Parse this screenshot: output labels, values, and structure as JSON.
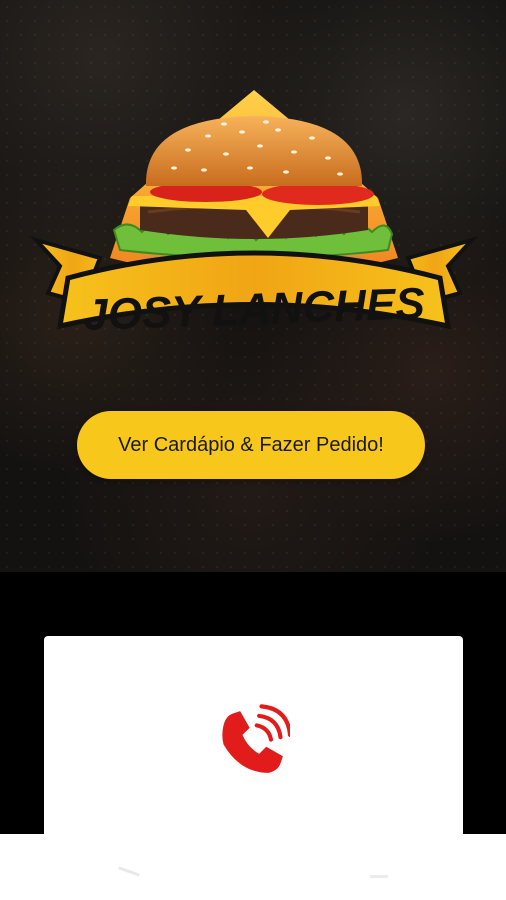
{
  "brand": {
    "name": "JOSY LANCHES"
  },
  "cta": {
    "label": "Ver Cardápio & Fazer Pedido!"
  },
  "contact": {
    "icon": "phone-call-icon"
  },
  "colors": {
    "accent": "#f7c71b",
    "phone": "#e21b1b",
    "ribbon": "#f2b21a"
  }
}
